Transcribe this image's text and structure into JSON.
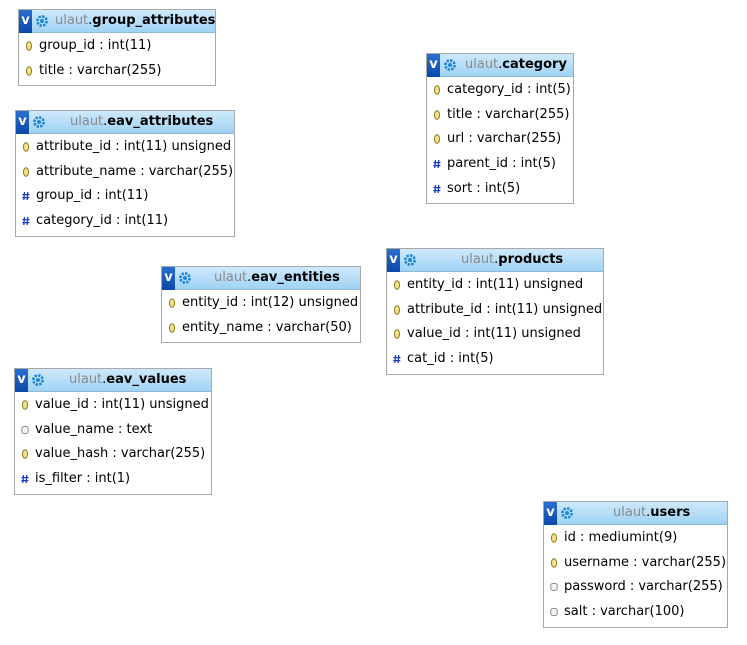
{
  "tables": [
    {
      "schema": "ulaut",
      "name": "group_attributes",
      "columns": [
        {
          "icon": "key-icon",
          "text": "group_id : int(11)"
        },
        {
          "icon": "key-icon",
          "text": "title : varchar(255)"
        }
      ]
    },
    {
      "schema": "ulaut",
      "name": "eav_attributes",
      "columns": [
        {
          "icon": "key-icon",
          "text": "attribute_id : int(11) unsigned"
        },
        {
          "icon": "key-icon",
          "text": "attribute_name : varchar(255)"
        },
        {
          "icon": "hash-icon",
          "text": "group_id : int(11)"
        },
        {
          "icon": "hash-icon",
          "text": "category_id : int(11)"
        }
      ]
    },
    {
      "schema": "ulaut",
      "name": "eav_entities",
      "columns": [
        {
          "icon": "key-icon",
          "text": "entity_id : int(12) unsigned"
        },
        {
          "icon": "key-icon",
          "text": "entity_name : varchar(50)"
        }
      ]
    },
    {
      "schema": "ulaut",
      "name": "eav_values",
      "columns": [
        {
          "icon": "key-icon",
          "text": "value_id : int(11) unsigned"
        },
        {
          "icon": "field-icon",
          "text": "value_name : text"
        },
        {
          "icon": "key-icon",
          "text": "value_hash : varchar(255)"
        },
        {
          "icon": "hash-icon",
          "text": "is_filter : int(1)"
        }
      ]
    },
    {
      "schema": "ulaut",
      "name": "category",
      "columns": [
        {
          "icon": "key-icon",
          "text": "category_id : int(5)"
        },
        {
          "icon": "key-icon",
          "text": "title : varchar(255)"
        },
        {
          "icon": "key-icon",
          "text": "url : varchar(255)"
        },
        {
          "icon": "hash-icon",
          "text": "parent_id : int(5)"
        },
        {
          "icon": "hash-icon",
          "text": "sort : int(5)"
        }
      ]
    },
    {
      "schema": "ulaut",
      "name": "products",
      "columns": [
        {
          "icon": "key-icon",
          "text": "entity_id : int(11) unsigned"
        },
        {
          "icon": "key-icon",
          "text": "attribute_id : int(11) unsigned"
        },
        {
          "icon": "key-icon",
          "text": "value_id : int(11) unsigned"
        },
        {
          "icon": "hash-icon",
          "text": "cat_id : int(5)"
        }
      ]
    },
    {
      "schema": "ulaut",
      "name": "users",
      "columns": [
        {
          "icon": "key-icon",
          "text": "id : mediumint(9)"
        },
        {
          "icon": "key-icon",
          "text": "username : varchar(255)"
        },
        {
          "icon": "field-icon",
          "text": "password : varchar(255)"
        },
        {
          "icon": "field-icon",
          "text": "salt : varchar(100)"
        }
      ]
    }
  ],
  "toggle_label": "v",
  "colors": {
    "header_top": "#cfe9fb",
    "header_bottom": "#9fd3f4",
    "toggle": "#0b47a8",
    "key": "#c9a227",
    "hash": "#1a3cc4",
    "schema_text": "#8a8a8a"
  }
}
